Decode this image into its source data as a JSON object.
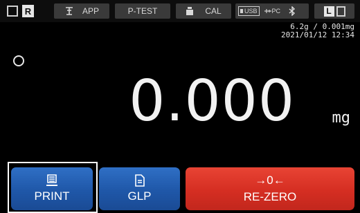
{
  "statusbar": {
    "r_label": "R",
    "app_label": "APP",
    "ptest_label": "P-TEST",
    "cal_label": "CAL",
    "usb_label": "USB",
    "pc_label": "PC",
    "l_label": "L"
  },
  "display": {
    "range": "6.2g / 0.001mg",
    "datetime": "2021/01/12 12:34",
    "value": "0.000",
    "unit": "mg"
  },
  "keys": {
    "print_label": "PRINT",
    "glp_label": "GLP",
    "rezero_symbol": "→0←",
    "rezero_label": "RE-ZERO"
  },
  "colors": {
    "blue_key": "#2f6fc5",
    "red_key": "#e84434",
    "background": "#000000"
  },
  "icons": [
    "battery-outline-icon",
    "balance-icon",
    "weight-icon",
    "usb-icon",
    "pc-connection-icon",
    "bluetooth-icon",
    "receipt-icon",
    "document-icon"
  ]
}
